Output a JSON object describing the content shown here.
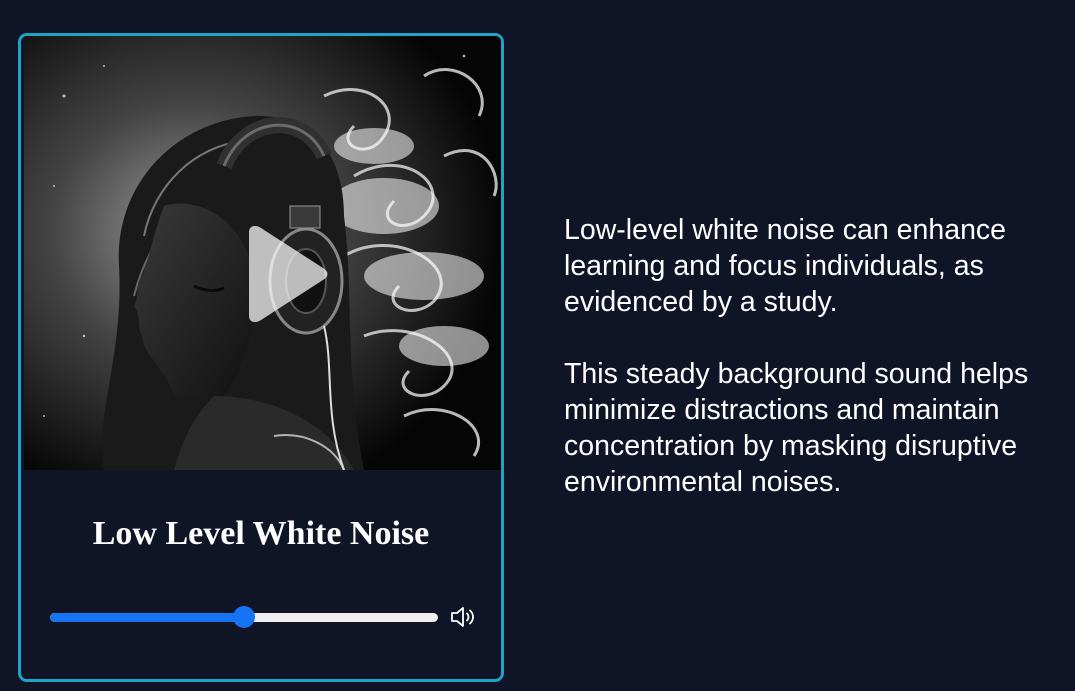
{
  "player": {
    "title": "Low Level White Noise",
    "volume": 0.5,
    "accent_color": "#1474f4",
    "border_color": "#1fa3c7",
    "artwork_icon": "headphones-anime-girl-artwork",
    "play_icon": "play-icon",
    "volume_icon": "speaker-volume-icon"
  },
  "description": {
    "paragraphs": [
      "Low-level white noise can enhance learning and focus individuals, as evidenced by a study.",
      "This steady background sound helps minimize distractions and maintain concentration by masking disruptive environmental noises."
    ]
  }
}
